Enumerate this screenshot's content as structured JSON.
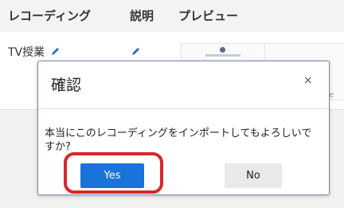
{
  "table": {
    "headers": {
      "recording": "レコーディング",
      "description": "説明",
      "preview": "プレビュー"
    },
    "row": {
      "name": "TV授業",
      "edit_icon": "pencil-icon",
      "size_label": "ze"
    }
  },
  "dialog": {
    "title": "確認",
    "close_label": "×",
    "message": "本当にこのレコーディングをインポートしてもよろしいですか?",
    "yes_label": "Yes",
    "no_label": "No"
  },
  "colors": {
    "accent": "#1a73d9",
    "highlight": "#d9262b",
    "edit_icon": "#2b6cc4"
  }
}
